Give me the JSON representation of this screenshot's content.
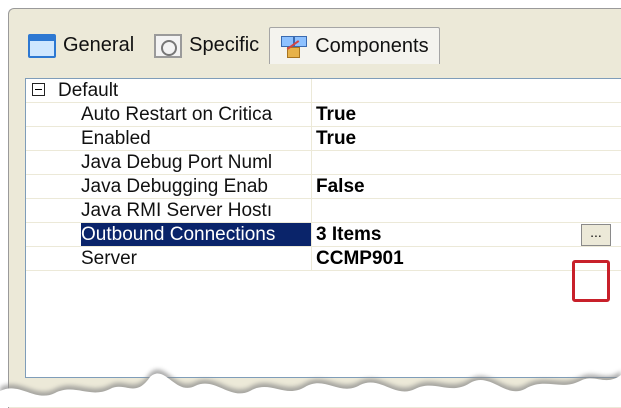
{
  "tabs": [
    {
      "label": "General",
      "icon": "general-tab-icon",
      "active": false
    },
    {
      "label": "Specific",
      "icon": "specific-tab-icon",
      "active": false
    },
    {
      "label": "Components",
      "icon": "components-tab-icon",
      "active": true
    }
  ],
  "grid": {
    "category": {
      "label": "Default",
      "expanded": true
    },
    "rows": [
      {
        "name": "Auto Restart on Critica",
        "value": "True"
      },
      {
        "name": "Enabled",
        "value": "True"
      },
      {
        "name": "Java Debug Port Numl",
        "value": ""
      },
      {
        "name": "Java Debugging Enab",
        "value": "False"
      },
      {
        "name": "Java RMI Server Hostı",
        "value": ""
      },
      {
        "name": "Outbound Connections",
        "value": "3 Items",
        "selected": true,
        "has_ellipsis": true
      },
      {
        "name": "Server",
        "value": "CCMP901"
      }
    ],
    "ellipsis_label": "...",
    "highlight_color": "#c8202a",
    "selection_color": "#0a246a"
  }
}
